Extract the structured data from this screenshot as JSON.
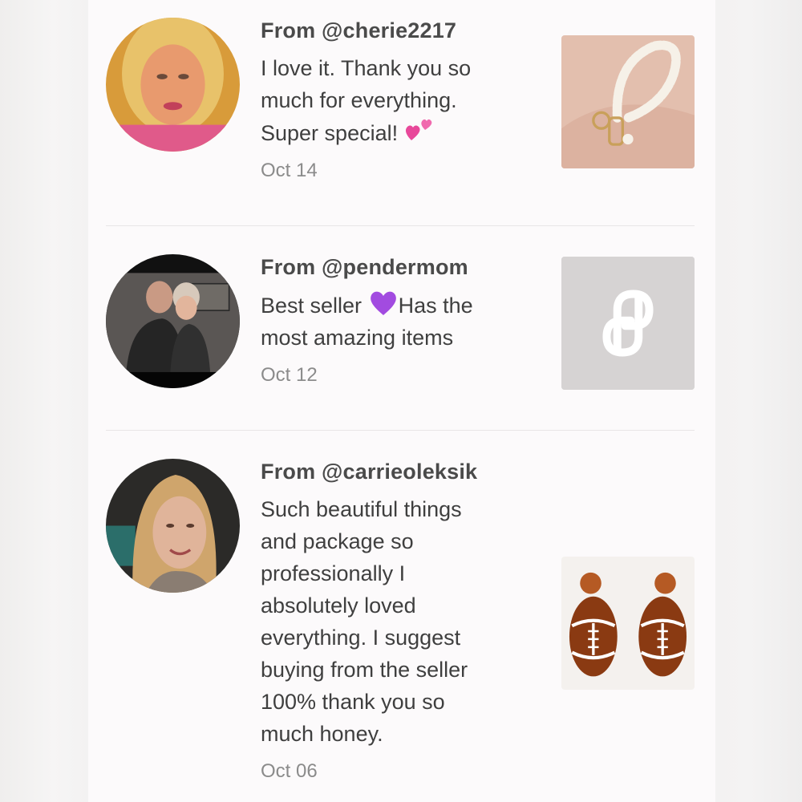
{
  "reviews": [
    {
      "user": "From @cherie2217",
      "lines": [
        "I love it. Thank you so",
        "much for everything.",
        "Super special!"
      ],
      "emoji": "two-hearts-icon",
      "date": "Oct 14",
      "thumbnail": "pearl-keychain-photo"
    },
    {
      "user": "From @pendermom",
      "lines": [
        "Best seller",
        "Has the",
        "most amazing items"
      ],
      "emoji": "purple-heart-icon",
      "date": "Oct 12",
      "thumbnail": "poshmark-placeholder-icon"
    },
    {
      "user": "From @carrieoleksik",
      "lines": [
        "Such beautiful things",
        "and package so",
        "professionally I",
        "absolutely loved",
        "everything. I suggest",
        "buying from the seller",
        "100% thank you so",
        "much honey."
      ],
      "date": "Oct 06",
      "thumbnail": "football-earrings-photo"
    }
  ],
  "colors": {
    "panel": "#fcfafb",
    "username": "#4a4a4a",
    "date": "#8b8b8b",
    "placeholder": "#d6d3d3"
  }
}
